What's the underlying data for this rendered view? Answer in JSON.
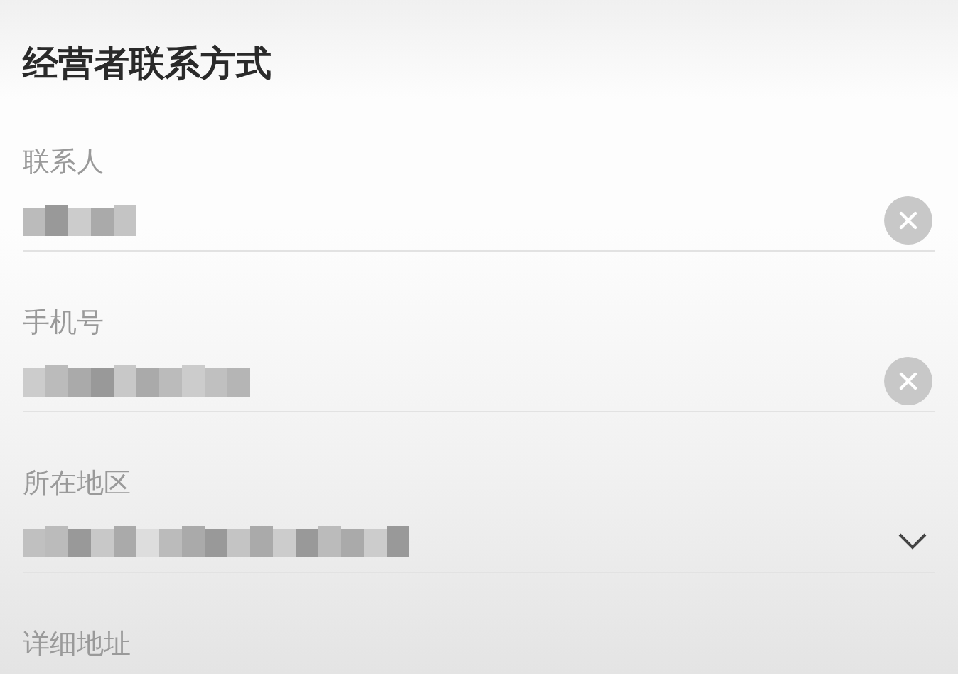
{
  "section": {
    "title": "经营者联系方式"
  },
  "fields": [
    {
      "label": "联系人",
      "kind": "text"
    },
    {
      "label": "手机号",
      "kind": "text"
    },
    {
      "label": "所在地区",
      "kind": "select"
    },
    {
      "label": "详细地址",
      "kind": "partial"
    }
  ]
}
